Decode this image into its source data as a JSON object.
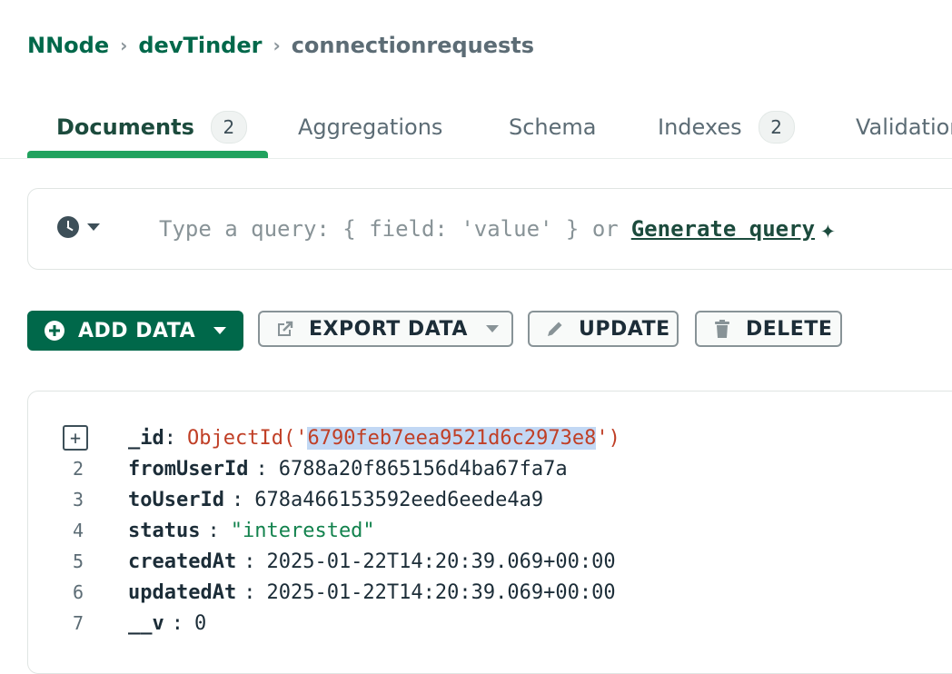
{
  "breadcrumb": {
    "items": [
      "NNode",
      "devTinder",
      "connectionrequests"
    ]
  },
  "tabs": [
    {
      "label": "Documents",
      "count": "2"
    },
    {
      "label": "Aggregations"
    },
    {
      "label": "Schema"
    },
    {
      "label": "Indexes",
      "count": "2"
    },
    {
      "label": "Validation"
    }
  ],
  "query": {
    "placeholder": "Type a query: { field: 'value' } or",
    "generate_link": "Generate query"
  },
  "toolbar": {
    "add_data": "ADD DATA",
    "export_data": "EXPORT DATA",
    "update": "UPDATE",
    "delete": "DELETE"
  },
  "document": {
    "id_prefix": "ObjectId('",
    "id_value": "6790feb7eea9521d6c2973e8",
    "id_suffix": "')",
    "lines": [
      {
        "n": "2",
        "key": "fromUserId",
        "value": "6788a20f865156d4ba67fa7a",
        "type": "plain"
      },
      {
        "n": "3",
        "key": "toUserId",
        "value": "678a466153592eed6eede4a9",
        "type": "plain"
      },
      {
        "n": "4",
        "key": "status",
        "value": "\"interested\"",
        "type": "string"
      },
      {
        "n": "5",
        "key": "createdAt",
        "value": "2025-01-22T14:20:39.069+00:00",
        "type": "plain"
      },
      {
        "n": "6",
        "key": "updatedAt",
        "value": "2025-01-22T14:20:39.069+00:00",
        "type": "plain"
      },
      {
        "n": "7",
        "key": "__v",
        "value": "0",
        "type": "plain"
      }
    ],
    "id_key": "_id"
  },
  "colors": {
    "brand_green": "#00684a",
    "tab_underline": "#21a25e",
    "objectid_red": "#c03f26",
    "string_green": "#12824d"
  }
}
